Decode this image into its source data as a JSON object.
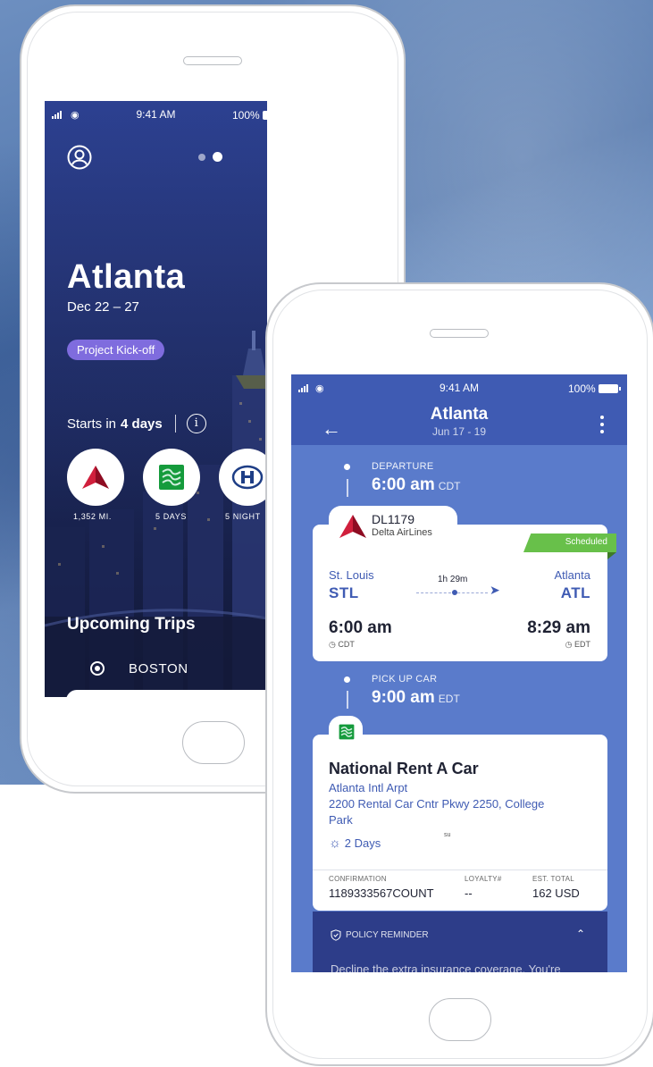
{
  "colors": {
    "accent_blue": "#3f5bb3",
    "tag_purple": "#7f6cde",
    "scheduled_green": "#68c04a",
    "delta_red": "#c8102e",
    "national_green": "#159b3c"
  },
  "trip_overview": {
    "status_bar": {
      "time": "9:41 AM",
      "battery": "100%"
    },
    "page_indicator": {
      "count": 2,
      "active": 2
    },
    "city": "Atlanta",
    "dates": "Dec 22 – 27",
    "tag": "Project Kick-off",
    "starts_prefix": "Starts in",
    "starts_value": "4 days",
    "info_icon": "i",
    "stats": [
      {
        "icon": "delta-logo-icon",
        "label": "1,352 MI."
      },
      {
        "icon": "national-logo-icon",
        "label": "5 DAYS"
      },
      {
        "icon": "hilton-logo-icon",
        "label": "5 NIGHT"
      }
    ],
    "upcoming_title": "Upcoming Trips",
    "upcoming_trips": [
      {
        "city": "BOSTON"
      }
    ]
  },
  "itinerary": {
    "status_bar": {
      "time": "9:41 AM",
      "battery": "100%"
    },
    "header": {
      "title": "Atlanta",
      "subtitle": "Jun 17 - 19"
    },
    "departure": {
      "label": "DEPARTURE",
      "time": "6:00 am",
      "tz": "CDT"
    },
    "flight": {
      "number": "DL1179",
      "airline": "Delta AirLines",
      "status": "Scheduled",
      "from_city": "St. Louis",
      "from_code": "STL",
      "to_city": "Atlanta",
      "to_code": "ATL",
      "duration": "1h 29m",
      "depart_time": "6:00 am",
      "depart_tz": "CDT",
      "arrive_time": "8:29 am",
      "arrive_tz": "EDT"
    },
    "pickup": {
      "label": "PICK UP CAR",
      "time": "9:00 am",
      "tz": "EDT"
    },
    "car": {
      "name": "National Rent A Car",
      "location": "Atlanta Intl Arpt",
      "address_line1": "2200 Rental Car Cntr Pkwy 2250, College",
      "address_line2": "Park",
      "duration": "2 Days",
      "stray_text": "su",
      "confirmation_label": "CONFIRMATION",
      "confirmation": "1189333567COUNT",
      "loyalty_label": "LOYALTY#",
      "loyalty": "--",
      "total_label": "EST. TOTAL",
      "total": "162 USD"
    },
    "policy": {
      "label": "POLICY REMINDER",
      "text": "Decline the extra insurance coverage. You're"
    }
  }
}
